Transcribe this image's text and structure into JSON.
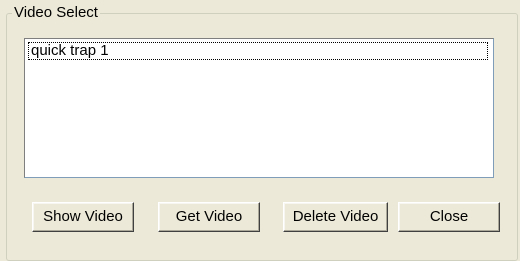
{
  "group": {
    "title": "Video Select"
  },
  "list": {
    "items": [
      "quick trap 1"
    ]
  },
  "buttons": {
    "show": "Show Video",
    "get": "Get Video",
    "delete": "Delete Video",
    "close": "Close"
  }
}
